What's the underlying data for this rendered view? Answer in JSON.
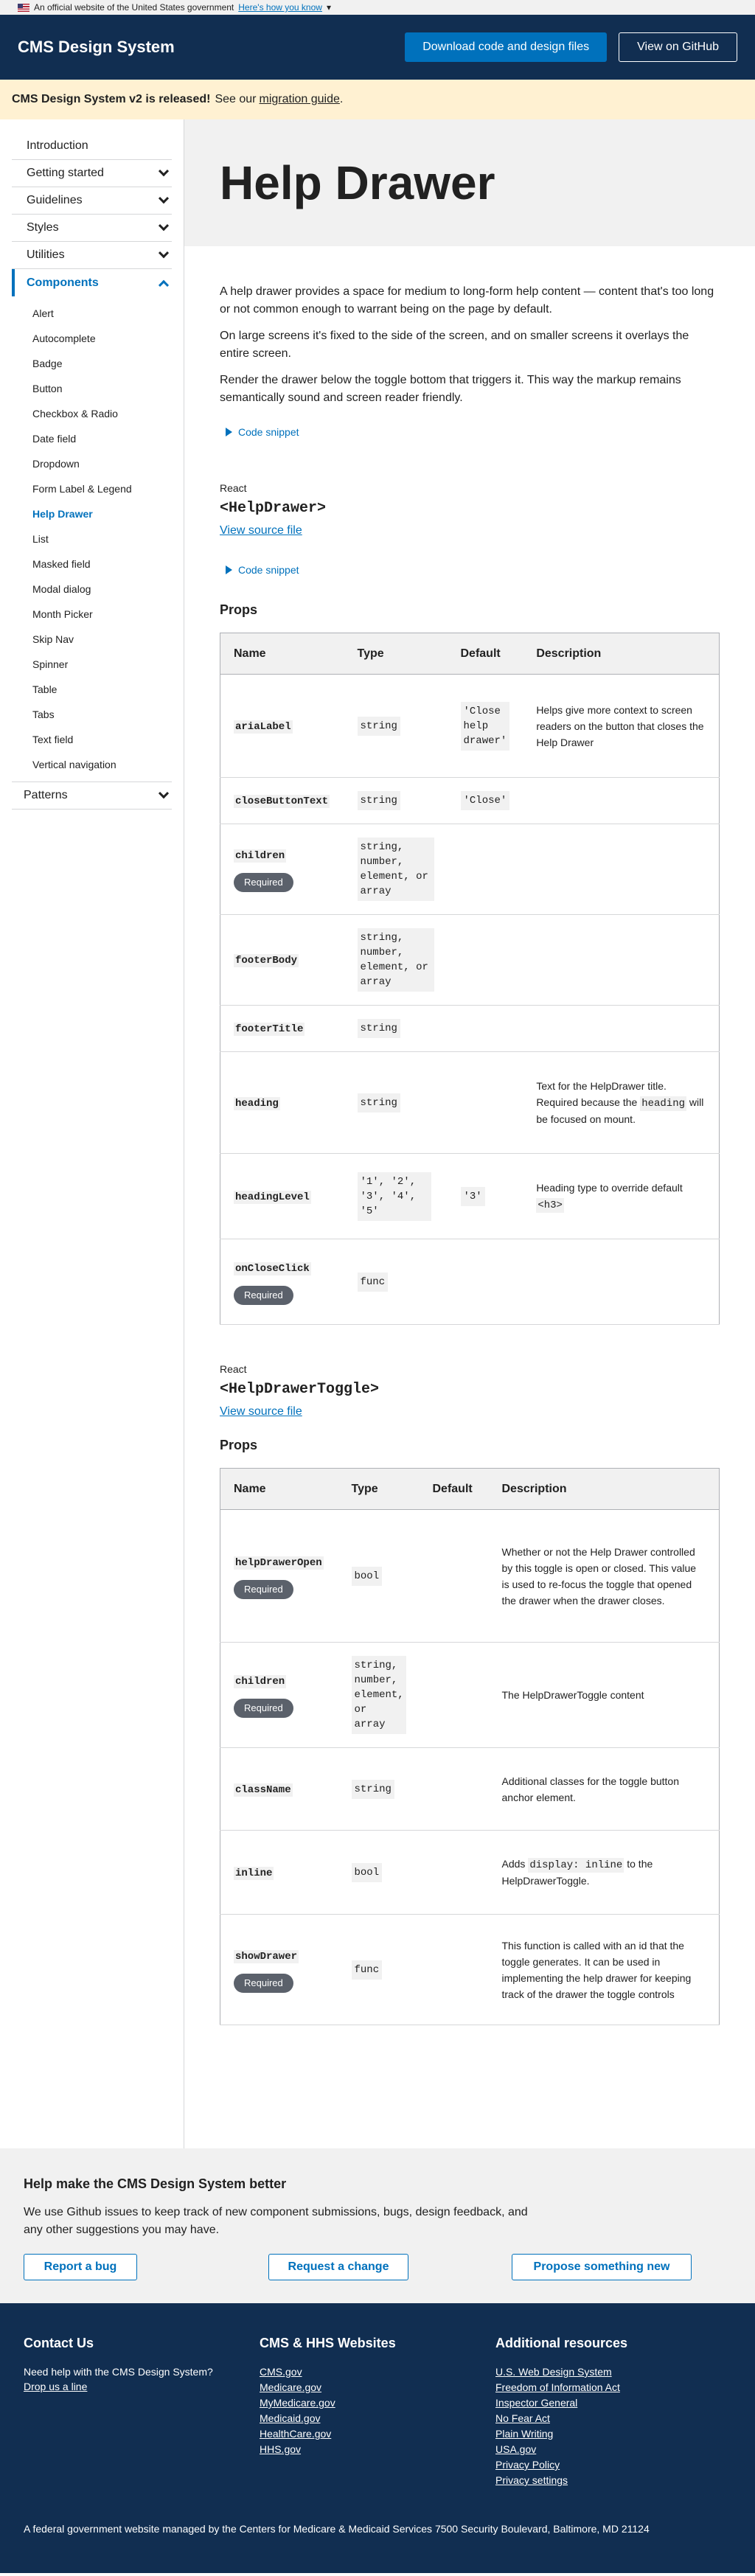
{
  "banner": {
    "text": "An official website of the United States government",
    "link": "Here's how you know",
    "chevron": "▾"
  },
  "header": {
    "title": "CMS Design System",
    "download_button": "Download code and design files",
    "github_button": "View on GitHub"
  },
  "alert": {
    "bold": "CMS Design System v2 is released!",
    "text": "See our",
    "link": "migration guide",
    "end": "."
  },
  "sidebar": {
    "items": [
      {
        "label": "Introduction"
      },
      {
        "label": "Getting started"
      },
      {
        "label": "Guidelines"
      },
      {
        "label": "Styles"
      },
      {
        "label": "Utilities"
      },
      {
        "label": "Components"
      },
      {
        "label": "Patterns"
      }
    ],
    "components": [
      "Alert",
      "Autocomplete",
      "Badge",
      "Button",
      "Checkbox & Radio",
      "Date field",
      "Dropdown",
      "Form Label & Legend",
      "Help Drawer",
      "List",
      "Masked field",
      "Modal dialog",
      "Month Picker",
      "Skip Nav",
      "Spinner",
      "Table",
      "Tabs",
      "Text field",
      "Vertical navigation"
    ]
  },
  "page": {
    "title": "Help Drawer",
    "intro": [
      "A help drawer provides a space for medium to long-form help content — content that's too long or not common enough to warrant being on the page by default.",
      "On large screens it's fixed to the side of the screen, and on smaller screens it overlays the entire screen.",
      "Render the drawer below the toggle bottom that triggers it. This way the markup remains semantically sound and screen reader friendly."
    ],
    "code_snippet": "Code snippet"
  },
  "helpdrawer": {
    "react": "React",
    "name": "<HelpDrawer>",
    "source": "View source file",
    "snippet": "Code snippet",
    "props_heading": "Props",
    "headers": {
      "name": "Name",
      "type": "Type",
      "default": "Default",
      "description": "Description"
    },
    "required": "Required",
    "rows": {
      "ariaLabel": {
        "name": "ariaLabel",
        "type": "string",
        "default": "'Close help drawer'",
        "description": "Helps give more context to screen readers on the button that closes the Help Drawer"
      },
      "closeButtonText": {
        "name": "closeButtonText",
        "type": "string",
        "default": "'Close'"
      },
      "children": {
        "name": "children",
        "type": "string, number, element, or array"
      },
      "footerBody": {
        "name": "footerBody",
        "type": "string, number, element, or array"
      },
      "footerTitle": {
        "name": "footerTitle",
        "type": "string"
      },
      "heading": {
        "name": "heading",
        "type": "string",
        "desc_a": "Text for the HelpDrawer title. Required because the",
        "desc_code": "heading",
        "desc_b": "will be focused on mount."
      },
      "headingLevel": {
        "name": "headingLevel",
        "type": "'1', '2', '3', '4', '5'",
        "default": "'3'",
        "desc_a": "Heading type to override default",
        "desc_code": "<h3>"
      },
      "onCloseClick": {
        "name": "onCloseClick",
        "type": "func"
      }
    }
  },
  "toggle": {
    "react": "React",
    "name": "<HelpDrawerToggle>",
    "source": "View source file",
    "props_heading": "Props",
    "headers": {
      "name": "Name",
      "type": "Type",
      "default": "Default",
      "description": "Description"
    },
    "required": "Required",
    "rows": {
      "helpDrawerOpen": {
        "name": "helpDrawerOpen",
        "type": "bool",
        "description": "Whether or not the Help Drawer controlled by this toggle is open or closed. This value is used to re-focus the toggle that opened the drawer when the drawer closes."
      },
      "children": {
        "name": "children",
        "type": "string, number, element, or array",
        "description": "The HelpDrawerToggle content"
      },
      "className": {
        "name": "className",
        "type": "string",
        "description": "Additional classes for the toggle button anchor element."
      },
      "inline": {
        "name": "inline",
        "type": "bool",
        "desc_a": "Adds",
        "desc_code": "display: inline",
        "desc_b": "to the HelpDrawerToggle."
      },
      "showDrawer": {
        "name": "showDrawer",
        "type": "func",
        "description": "This function is called with an id that the toggle generates. It can be used in implementing the help drawer for keeping track of the drawer the toggle controls"
      }
    }
  },
  "feedback": {
    "title": "Help make the CMS Design System better",
    "text": "We use Github issues to keep track of new component submissions, bugs, design feedback, and any other suggestions you may have.",
    "buttons": [
      "Report a bug",
      "Request a change",
      "Propose something new"
    ]
  },
  "footer": {
    "contact": {
      "title": "Contact Us",
      "text": "Need help with the CMS Design System?",
      "link": "Drop us a line"
    },
    "cms": {
      "title": "CMS & HHS Websites",
      "links": [
        "CMS.gov",
        "Medicare.gov",
        "MyMedicare.gov",
        "Medicaid.gov",
        "HealthCare.gov",
        "HHS.gov"
      ]
    },
    "resources": {
      "title": "Additional resources",
      "links": [
        "U.S. Web Design System",
        "Freedom of Information Act",
        "Inspector General",
        "No Fear Act",
        "Plain Writing",
        "USA.gov",
        "Privacy Policy",
        "Privacy settings"
      ]
    },
    "bottom": "A federal government website managed by the Centers for Medicare & Medicaid Services 7500 Security Boulevard, Baltimore, MD 21124"
  }
}
